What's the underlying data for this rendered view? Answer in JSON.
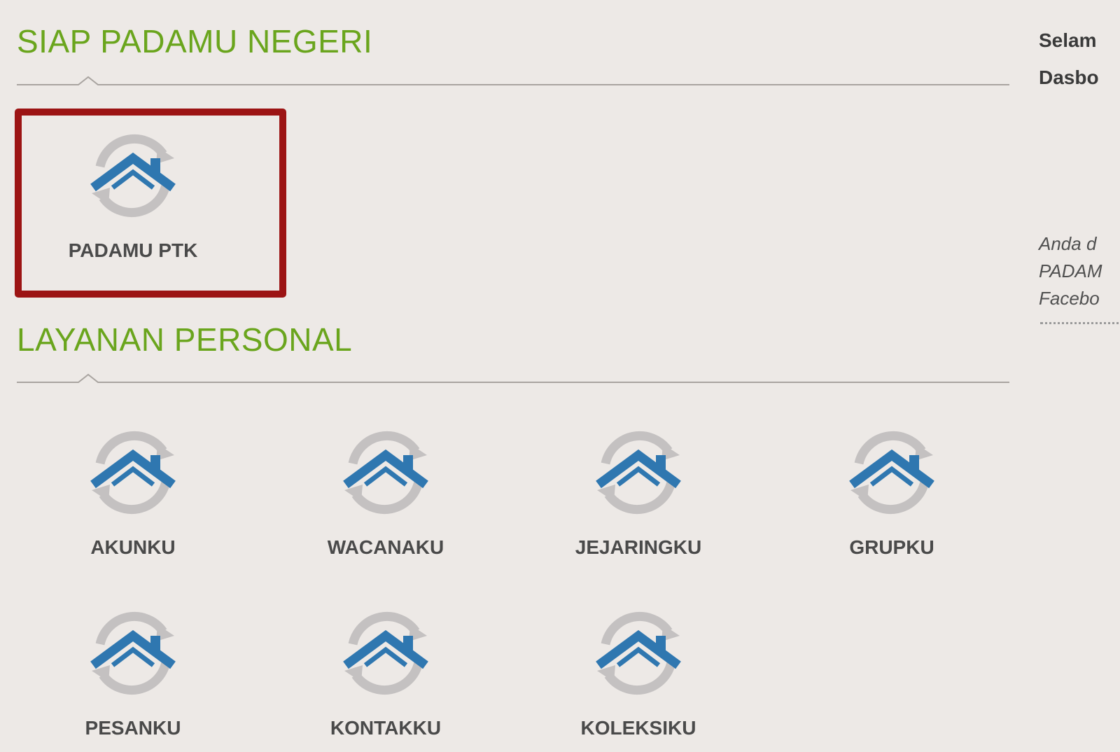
{
  "sections": [
    {
      "title": "SIAP PADAMU NEGERI"
    },
    {
      "title": "LAYANAN PERSONAL"
    }
  ],
  "tiles": [
    {
      "label": "PADAMU PTK",
      "icon": "padamu-house-icon"
    },
    {
      "label": "AKUNKU",
      "icon": "padamu-house-icon"
    },
    {
      "label": "WACANAKU",
      "icon": "padamu-house-icon"
    },
    {
      "label": "JEJARINGKU",
      "icon": "padamu-house-icon"
    },
    {
      "label": "GRUPKU",
      "icon": "padamu-house-icon"
    },
    {
      "label": "PESANKU",
      "icon": "padamu-house-icon"
    },
    {
      "label": "KONTAKKU",
      "icon": "padamu-house-icon"
    },
    {
      "label": "KOLEKSIKU",
      "icon": "padamu-house-icon"
    }
  ],
  "sidebar": {
    "line1": "Selam",
    "line2": "Dasbo",
    "note_lines": [
      "Anda d",
      "PADAM",
      "Facebo"
    ]
  },
  "colors": {
    "title_green": "#6aa51d",
    "icon_blue": "#2f77b0",
    "icon_gray": "#c4c1c1",
    "highlight_red": "#9c1414",
    "background": "#ede9e6"
  }
}
